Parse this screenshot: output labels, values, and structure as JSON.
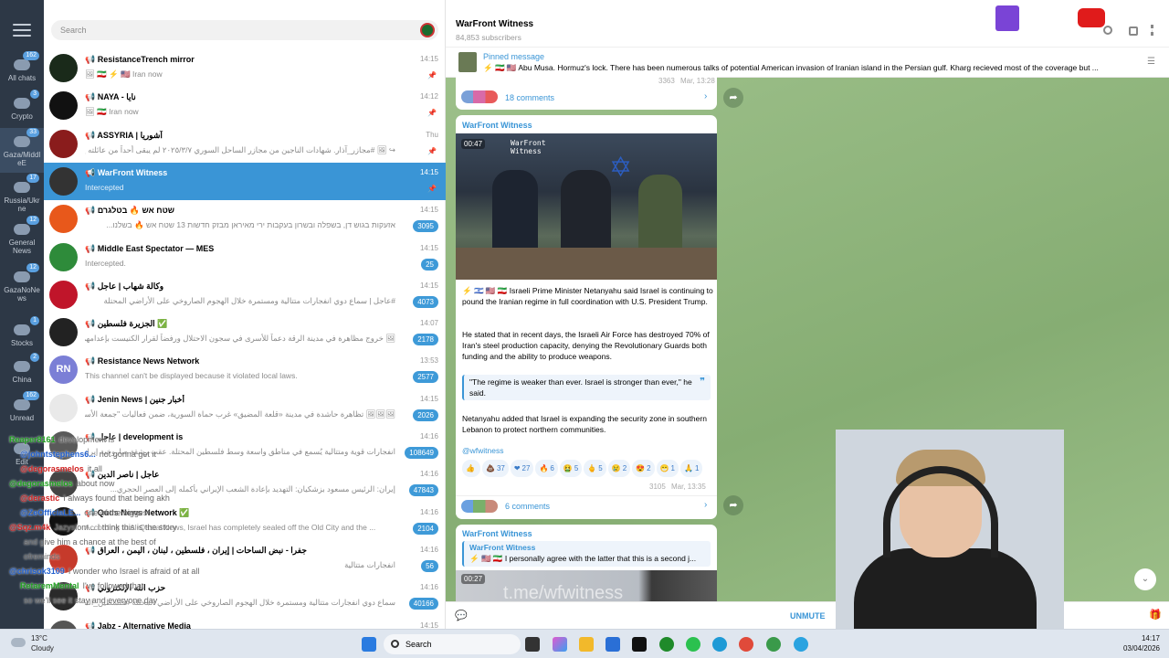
{
  "window": {
    "colors": {
      "accent": "#3a95d6",
      "selected": "#3a95d6",
      "channel_bg": "#8fb57e"
    }
  },
  "folders": [
    {
      "label": "All chats",
      "badge": "162",
      "icon": "chat-bubble-icon"
    },
    {
      "label": "Crypto",
      "badge": "3",
      "icon": "chat-bubble-icon"
    },
    {
      "label": "Gaza/Middl eE",
      "badge": "33",
      "icon": "chat-bubble-icon"
    },
    {
      "label": "Russia/Ukr ne",
      "badge": "17",
      "icon": "chat-bubble-icon"
    },
    {
      "label": "General News",
      "badge": "12",
      "icon": "chat-bubble-icon"
    },
    {
      "label": "GazaNoNe ws",
      "badge": "12",
      "icon": "chat-bubble-icon"
    },
    {
      "label": "Stocks",
      "badge": "1",
      "icon": "chat-bubble-icon"
    },
    {
      "label": "China",
      "badge": "2",
      "icon": "chat-bubble-icon"
    },
    {
      "label": "Unread",
      "badge": "162",
      "icon": "chat-bubble-icon"
    },
    {
      "label": "Edit",
      "badge": "",
      "icon": "edit-icon"
    }
  ],
  "search": {
    "placeholder": "Search"
  },
  "chats": [
    {
      "name": "📢 ResistanceTrench mirror",
      "preview": "🖼 🇮🇷 ⚡ 🇺🇸 Iran now",
      "time": "14:15",
      "count": "",
      "pinned": true,
      "avatar_color": "#1a2a1a",
      "avatar_text": ""
    },
    {
      "name": "📢 NAYA - نايا",
      "preview": "🖼 🇮🇷 Iran now",
      "time": "14:12",
      "count": "",
      "pinned": true,
      "avatar_color": "#111111",
      "avatar_text": ""
    },
    {
      "name": "📢 ASSYRIA | آشوريا",
      "preview": "↪ 🖼 #مجازر_آذار. شهادات الناجين من مجازر الساحل السوري ٢٠٢٥/٣/٧ لم يبقى أحداً من عائلته إلا ذلك ال...",
      "time": "Thu",
      "count": "",
      "pinned": true,
      "avatar_color": "#8a1c1c",
      "avatar_text": ""
    },
    {
      "name": "📢 WarFront Witness",
      "preview": "Intercepted",
      "time": "14:15",
      "count": "",
      "pinned": true,
      "avatar_color": "#333333",
      "avatar_text": ""
    },
    {
      "name": "📢 שטח אש 🔥 בטלגרם",
      "preview": "אזעקות בגוש דן, בשפלה ובשרון בעקבות ירי מאיראן מבזק חדשות 13 שטח אש 🔥 בשלנו...",
      "time": "14:15",
      "count": "3095",
      "pinned": false,
      "avatar_color": "#e8581b",
      "avatar_text": ""
    },
    {
      "name": "📢 Middle East Spectator — MES",
      "preview": "Intercepted.",
      "time": "14:15",
      "count": "25",
      "pinned": false,
      "avatar_color": "#2e8b3a",
      "avatar_text": ""
    },
    {
      "name": "📢 وكالة شهاب | عاجل",
      "preview": "#عاجل | سماع دوي انفجارات متتالية ومستمرة خلال الهجوم الصاروخي على الأراضي المحتلة",
      "time": "14:15",
      "count": "4073",
      "pinned": false,
      "avatar_color": "#c0152a",
      "avatar_text": ""
    },
    {
      "name": "📢 الجزيرة فلسطين ✅",
      "preview": "🖼 خروج مظاهرة في مدينة الرقة دعماً للأسرى في سجون الاحتلال ورفضاً لقرار الكنيست بإعدامهم #فيديو",
      "time": "14:07",
      "count": "2178",
      "pinned": false,
      "avatar_color": "#222222",
      "avatar_text": ""
    },
    {
      "name": "📢 Resistance News Network",
      "preview": "This channel can't be displayed because it violated local laws.",
      "time": "13:53",
      "count": "2577",
      "pinned": false,
      "avatar_color": "#7b7fd6",
      "avatar_text": "RN"
    },
    {
      "name": "📢 Jenin News | أخبار جنين",
      "preview": "🖼🖼🖼 تظاهرة حاشدة في مدينة «قلعة المضيق» غرب حماة السورية، ضمن فعاليات \"جمعة الأسرى والب...",
      "time": "14:15",
      "count": "2026",
      "pinned": false,
      "avatar_color": "#e9e9e9",
      "avatar_text": ""
    },
    {
      "name": "📢 عاجل | development is",
      "preview": "انفجارات قوية ومتتالية يُسمع في مناطق واسعة وسط فلسطين المحتلة. عقب رشقة صاروخية إيرانية",
      "time": "14:16",
      "count": "108649",
      "pinned": false,
      "avatar_color": "#5a5a5a",
      "avatar_text": ""
    },
    {
      "name": "📢 عاجل | ناصر الدين",
      "preview": "إيران: الرئيس مسعود بزشكيان: التهديد بإعادة الشعب الإيراني بأكمله إلى العصر الحجري...",
      "time": "14:16",
      "count": "47843",
      "pinned": false,
      "avatar_color": "#444444",
      "avatar_text": ""
    },
    {
      "name": "📢 Quds News Network ✅",
      "preview": "According to Al-Qastal News, Israel has completely sealed off the Old City and the ...",
      "time": "14:16",
      "count": "2104",
      "pinned": false,
      "avatar_color": "#111111",
      "avatar_text": ""
    },
    {
      "name": "📢 جفرا - نبض الساحات | إيران ، فلسطين ، لبنان ، اليمن ، العراق",
      "preview": "انفجارات متتالية",
      "time": "14:16",
      "count": "56",
      "pinned": false,
      "avatar_color": "#c63a2b",
      "avatar_text": ""
    },
    {
      "name": "📢 حزب الله الإلكتروني",
      "preview": "سماع دوي انفجارات متتالية ومستمرة خلال الهجوم الصاروخي على الأراضي المحتلة #فلسطين_المحتلة",
      "time": "14:16",
      "count": "40166",
      "pinned": false,
      "avatar_color": "#2a2a2a",
      "avatar_text": ""
    },
    {
      "name": "📢 Jabz - Alternative Media",
      "preview": "",
      "time": "14:15",
      "count": "",
      "pinned": false,
      "avatar_color": "#555555",
      "avatar_text": ""
    }
  ],
  "chat_overlay": [
    {
      "user": "Reaper8161",
      "text": "development is"
    },
    {
      "user": "@johntstephens6...",
      "text": "not gonna get it"
    },
    {
      "user": "@degorasmelos",
      "text": "it all"
    },
    {
      "user": "@degorasmelos",
      "text": "about now"
    },
    {
      "user": "@derastic",
      "text": "I always found that being akh"
    },
    {
      "user": "@ZeOfficiaLE...",
      "text": "one of the biggest"
    },
    {
      "user": "@Sqz.m4k",
      "text": "Jazyslom... I think this is the story"
    },
    {
      "user": "",
      "text": "and give him a chance at the best of"
    },
    {
      "user": "",
      "text": "ofreminds"
    },
    {
      "user": "@chrisok3109",
      "text": "I wonder who Israel is afraid of at all"
    },
    {
      "user": "RetaremMental",
      "text": "I've followed that"
    },
    {
      "user": "",
      "text": "so we'll see it stay and everyone day"
    }
  ],
  "channel": {
    "title": "WarFront Witness",
    "subscribers": "84,853 subscribers",
    "pinned_label": "Pinned message",
    "pinned_text": "⚡ 🇮🇷 🇺🇸 Abu Musa. Hormuz's lock.  There has been numerous talks of potential American invasion of Iranian island in the Persian gulf. Kharg recieved most of the coverage but ...",
    "prev_views": "3363",
    "prev_time": "Mar, 13:28",
    "prev_comments": "18 comments",
    "post": {
      "author": "WarFront Witness",
      "video_time": "00:47",
      "watermark": "WarFront Witness",
      "text1": "⚡ 🇮🇱 🇺🇸 🇮🇷 Israeli Prime Minister Netanyahu said Israel is continuing to pound the Iranian regime in full coordination with U.S. President Trump.",
      "text2": "He stated that in recent days, the Israeli Air Force has destroyed 70% of Iran's steel production capacity, denying the Revolutionary Guards both funding and the ability to produce weapons.",
      "quote": "\"The regime is weaker than ever. Israel is stronger than ever,\" he said.",
      "text3": "Netanyahu added that Israel is expanding the security zone in southern Lebanon to protect northern communities.",
      "tag": "@wfwitness",
      "reactions": [
        {
          "emoji": "👍",
          "count": ""
        },
        {
          "emoji": "💩",
          "count": "37"
        },
        {
          "emoji": "❤",
          "count": "27"
        },
        {
          "emoji": "🔥",
          "count": "6"
        },
        {
          "emoji": "🤮",
          "count": "5"
        },
        {
          "emoji": "🖕",
          "count": "5"
        },
        {
          "emoji": "😢",
          "count": "2"
        },
        {
          "emoji": "😍",
          "count": "2"
        },
        {
          "emoji": "😁",
          "count": "1"
        },
        {
          "emoji": "🙏",
          "count": "1"
        }
      ],
      "views": "3105",
      "time": "Mar, 13:35",
      "comments": "6 comments"
    },
    "next_post": {
      "author": "WarFront Witness",
      "reply_author": "WarFront Witness",
      "reply_text": "⚡ 🇺🇸 🇮🇷 I personally agree with the latter that this is a second j...",
      "video_time": "00:27",
      "watermark": "t.me/wfwitness"
    },
    "bottom_action": "UNMUTE"
  },
  "taskbar": {
    "weather_temp": "13°C",
    "weather_desc": "Cloudy",
    "search": "Search",
    "time": "14:17",
    "date": "03/04/2026"
  }
}
